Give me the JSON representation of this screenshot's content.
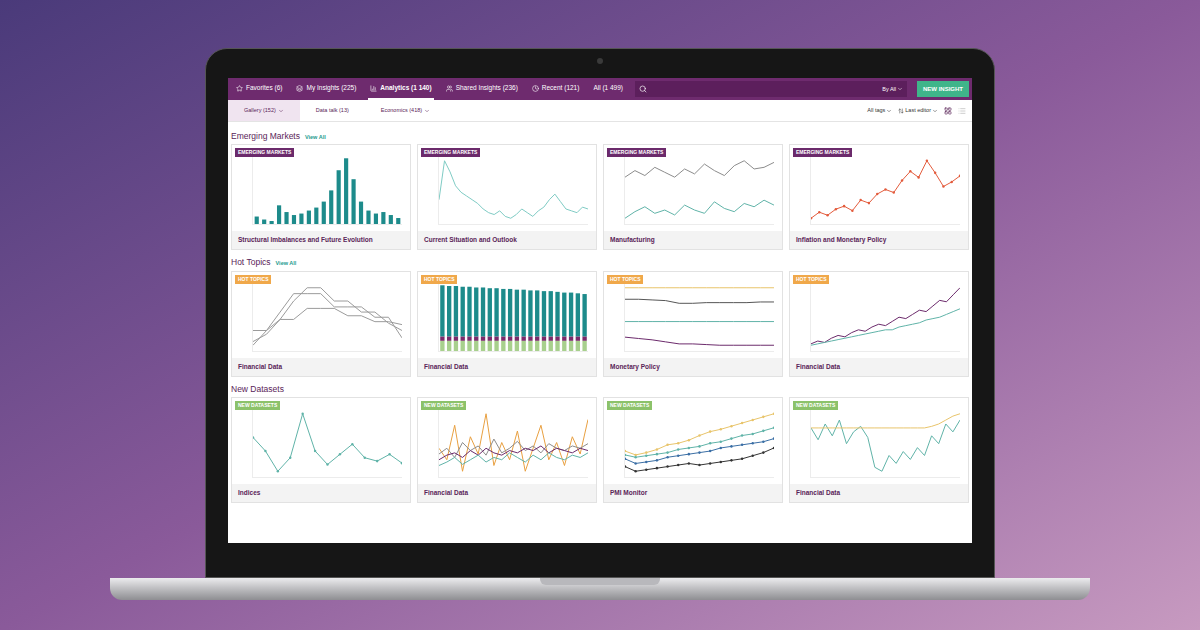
{
  "nav": {
    "items": [
      {
        "label": "Favorites (6)",
        "selected": false
      },
      {
        "label": "My Insights (225)",
        "selected": false
      },
      {
        "label": "Analytics (1 140)",
        "selected": true
      },
      {
        "label": "Shared Insights (236)",
        "selected": false
      },
      {
        "label": "Recent (121)",
        "selected": false
      },
      {
        "label": "All (1 499)",
        "selected": false
      }
    ],
    "search": {
      "scope": "By All"
    },
    "button": "NEW INSIGHT"
  },
  "subnav": {
    "tabs": [
      {
        "label": "Gallery (152)",
        "selected": true,
        "dropdown": true
      },
      {
        "label": "Data talk (13)",
        "selected": false,
        "dropdown": false
      },
      {
        "label": "Economics (418)",
        "selected": false,
        "dropdown": true
      }
    ],
    "filters": [
      "All tags",
      "Last editor"
    ],
    "views": [
      {
        "kind": "grid",
        "selected": true
      },
      {
        "kind": "list",
        "selected": false
      }
    ]
  },
  "sections": [
    {
      "title": "Emerging Markets",
      "link": "View All",
      "badge": "EMERGING MARKETS",
      "color": "#6b2a6b",
      "cards": [
        {
          "title": "Structural Imbalances and Future Evolution",
          "chart": {
            "kind": "bars",
            "series": [
              {
                "color": "#1d8b8b",
                "values": [
                  10,
                  6,
                  4,
                  25,
                  16,
                  12,
                  14,
                  18,
                  22,
                  30,
                  45,
                  72,
                  88,
                  60,
                  30,
                  18,
                  14,
                  16,
                  12,
                  8
                ]
              }
            ]
          }
        },
        {
          "title": "Current Situation and Outlook",
          "chart": {
            "kind": "lines",
            "series": [
              {
                "color": "#7ecbc4",
                "values": [
                  40,
                  82,
                  70,
                  55,
                  48,
                  44,
                  40,
                  36,
                  30,
                  26,
                  24,
                  28,
                  22,
                  20,
                  24,
                  30,
                  26,
                  22,
                  28,
                  32,
                  40,
                  46,
                  38,
                  30,
                  28,
                  26,
                  32,
                  30
                ]
              }
            ]
          }
        },
        {
          "title": "Manufacturing",
          "chart": {
            "kind": "lines",
            "series": [
              {
                "color": "#8c8c8c",
                "values": [
                  70,
                  78,
                  72,
                  82,
                  76,
                  70,
                  80,
                  74,
                  86,
                  78,
                  72,
                  84,
                  90,
                  80,
                  82,
                  88
                ]
              },
              {
                "color": "#5fb3a8",
                "values": [
                  20,
                  28,
                  34,
                  26,
                  30,
                  24,
                  36,
                  30,
                  26,
                  40,
                  32,
                  28,
                  38,
                  34,
                  42,
                  36
                ]
              }
            ]
          }
        },
        {
          "title": "Inflation and Monetary Policy",
          "chart": {
            "kind": "dots",
            "series": [
              {
                "color": "#e35b3c",
                "values": [
                  10,
                  18,
                  14,
                  22,
                  26,
                  20,
                  34,
                  30,
                  42,
                  48,
                  44,
                  60,
                  72,
                  64,
                  86,
                  70,
                  52,
                  58,
                  66
                ]
              }
            ]
          }
        }
      ]
    },
    {
      "title": "Hot Topics",
      "link": "View All",
      "badge": "HOT TOPICS",
      "color": "#f0a84a",
      "cards": [
        {
          "title": "Financial Data",
          "chart": {
            "kind": "lines",
            "series": [
              {
                "color": "#9b9b9b",
                "values": [
                  10,
                  30,
                  55,
                  80,
                  80,
                  80,
                  62,
                  62,
                  62,
                  48,
                  48,
                  20
                ]
              },
              {
                "color": "#9b9b9b",
                "values": [
                  15,
                  25,
                  45,
                  70,
                  88,
                  88,
                  70,
                  70,
                  55,
                  55,
                  40,
                  30
                ]
              },
              {
                "color": "#9b9b9b",
                "values": [
                  30,
                  30,
                  45,
                  45,
                  60,
                  60,
                  60,
                  50,
                  50,
                  42,
                  42,
                  38
                ]
              }
            ]
          }
        },
        {
          "title": "Financial Data",
          "chart": {
            "kind": "stacked",
            "series": [
              {
                "color": "#a8d08d",
                "values": [
                  14,
                  14,
                  14,
                  14,
                  14,
                  14,
                  14,
                  14,
                  14,
                  14,
                  14,
                  14,
                  14,
                  14,
                  14,
                  14,
                  14,
                  14,
                  14,
                  14,
                  14,
                  14
                ]
              },
              {
                "color": "#7a2a6a",
                "values": [
                  6,
                  6,
                  6,
                  6,
                  6,
                  6,
                  6,
                  6,
                  6,
                  6,
                  6,
                  6,
                  6,
                  6,
                  6,
                  6,
                  6,
                  6,
                  6,
                  6,
                  6,
                  6
                ]
              },
              {
                "color": "#1d8b8b",
                "values": [
                  70,
                  69,
                  69,
                  68,
                  68,
                  67,
                  67,
                  66,
                  66,
                  65,
                  65,
                  64,
                  64,
                  63,
                  63,
                  62,
                  62,
                  61,
                  60,
                  60,
                  59,
                  58
                ]
              }
            ]
          }
        },
        {
          "title": "Monetary Policy",
          "chart": {
            "kind": "lines",
            "series": [
              {
                "color": "#e8c46a",
                "values": [
                  95,
                  95,
                  95,
                  95,
                  95,
                  95,
                  95,
                  95,
                  95,
                  95,
                  95,
                  95
                ]
              },
              {
                "color": "#555555",
                "values": [
                  78,
                  78,
                  77,
                  76,
                  72,
                  72,
                  73,
                  73,
                  73,
                  73,
                  74,
                  74
                ]
              },
              {
                "color": "#5fb3a8",
                "values": [
                  45,
                  45,
                  45,
                  45,
                  45,
                  45,
                  45,
                  45,
                  45,
                  45,
                  45,
                  45
                ]
              },
              {
                "color": "#6b2a6b",
                "values": [
                  22,
                  20,
                  18,
                  15,
                  12,
                  12,
                  11,
                  10,
                  10,
                  10,
                  10,
                  10
                ]
              }
            ]
          }
        },
        {
          "title": "Financial Data",
          "chart": {
            "kind": "lines",
            "series": [
              {
                "color": "#6b2a6b",
                "values": [
                  10,
                  14,
                  12,
                  18,
                  22,
                  20,
                  26,
                  30,
                  28,
                  34,
                  38,
                  36,
                  42,
                  48,
                  46,
                  52,
                  58,
                  56,
                  64,
                  72,
                  70,
                  80,
                  90
                ]
              },
              {
                "color": "#5fb3a8",
                "values": [
                  8,
                  10,
                  12,
                  14,
                  16,
                  18,
                  20,
                  22,
                  24,
                  26,
                  28,
                  30,
                  30,
                  34,
                  36,
                  38,
                  40,
                  44,
                  46,
                  48,
                  52,
                  56,
                  60
                ]
              }
            ]
          }
        }
      ]
    },
    {
      "title": "New Datasets",
      "link": "",
      "badge": "NEW DATASETS",
      "color": "#8cc26a",
      "cards": [
        {
          "title": "Indices",
          "chart": {
            "kind": "dots",
            "series": [
              {
                "color": "#5fb3a8",
                "values": [
                  60,
                  40,
                  10,
                  30,
                  95,
                  40,
                  20,
                  35,
                  50,
                  30,
                  25,
                  35,
                  22
                ]
              }
            ]
          }
        },
        {
          "title": "Financial Data",
          "chart": {
            "kind": "lines",
            "series": [
              {
                "color": "#e8a040",
                "values": [
                  50,
                  40,
                  70,
                  30,
                  60,
                  45,
                  80,
                  35,
                  55,
                  40,
                  65,
                  30,
                  50,
                  70,
                  40,
                  55,
                  35,
                  60,
                  45,
                  75
                ]
              },
              {
                "color": "#8c8c8c",
                "values": [
                  45,
                  50,
                  42,
                  55,
                  48,
                  52,
                  44,
                  58,
                  46,
                  50,
                  56,
                  48,
                  52,
                  46,
                  54,
                  50,
                  48,
                  52,
                  50,
                  54
                ]
              },
              {
                "color": "#6b2a6b",
                "values": [
                  40,
                  44,
                  46,
                  42,
                  48,
                  44,
                  50,
                  46,
                  44,
                  48,
                  46,
                  50,
                  48,
                  52,
                  46,
                  50,
                  48,
                  46,
                  50,
                  48
                ]
              },
              {
                "color": "#5fb3a8",
                "values": [
                  35,
                  38,
                  42,
                  36,
                  40,
                  44,
                  38,
                  42,
                  40,
                  46,
                  42,
                  38,
                  44,
                  40,
                  46,
                  42,
                  40,
                  44,
                  42,
                  46
                ]
              }
            ]
          }
        },
        {
          "title": "PMI Monitor",
          "chart": {
            "kind": "dots",
            "series": [
              {
                "color": "#e8c46a",
                "values": [
                  30,
                  25,
                  28,
                  32,
                  38,
                  40,
                  44,
                  50,
                  55,
                  58,
                  62,
                  66,
                  70,
                  74,
                  78
                ]
              },
              {
                "color": "#5fb3a8",
                "values": [
                  25,
                  22,
                  24,
                  26,
                  28,
                  32,
                  34,
                  36,
                  40,
                  42,
                  46,
                  50,
                  52,
                  56,
                  60
                ]
              },
              {
                "color": "#3a6ea5",
                "values": [
                  20,
                  14,
                  16,
                  18,
                  22,
                  24,
                  26,
                  28,
                  30,
                  34,
                  36,
                  38,
                  40,
                  42,
                  46
                ]
              },
              {
                "color": "#333333",
                "values": [
                  10,
                  4,
                  6,
                  8,
                  10,
                  12,
                  14,
                  12,
                  14,
                  16,
                  18,
                  20,
                  24,
                  28,
                  34
                ]
              }
            ]
          }
        },
        {
          "title": "Financial Data",
          "chart": {
            "kind": "lines",
            "series": [
              {
                "color": "#5fb3a8",
                "values": [
                  70,
                  55,
                  75,
                  60,
                  80,
                  50,
                  65,
                  72,
                  58,
                  20,
                  15,
                  35,
                  25,
                  40,
                  30,
                  45,
                  35,
                  60,
                  50,
                  75,
                  65,
                  80
                ]
              },
              {
                "color": "#e8c46a",
                "values": [
                  70,
                  70,
                  70,
                  70,
                  70,
                  70,
                  70,
                  70,
                  70,
                  70,
                  70,
                  70,
                  70,
                  70,
                  70,
                  70,
                  70,
                  72,
                  75,
                  80,
                  85,
                  88
                ]
              }
            ]
          }
        }
      ]
    }
  ]
}
